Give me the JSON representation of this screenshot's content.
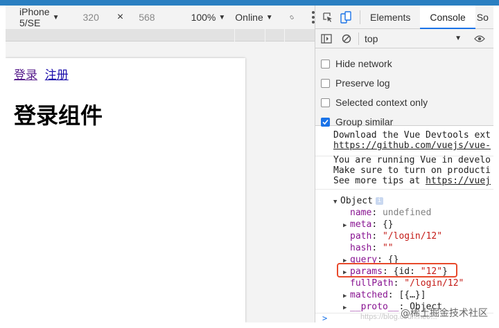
{
  "device_toolbar": {
    "device": "iPhone 5/SE",
    "width": "320",
    "times": "×",
    "height": "568",
    "zoom": "100%",
    "network": "Online"
  },
  "page": {
    "links": [
      "登录",
      "注册"
    ],
    "heading": "登录组件"
  },
  "devtools": {
    "tabs": [
      "Elements",
      "Console",
      "So"
    ],
    "active_tab": "Console",
    "context": "top",
    "options": [
      {
        "label": "Hide network",
        "checked": false
      },
      {
        "label": "Preserve log",
        "checked": false
      },
      {
        "label": "Selected context only",
        "checked": false
      },
      {
        "label": "Group similar",
        "checked": true
      }
    ],
    "messages": {
      "m1_line1": "Download the Vue Devtools ext",
      "m1_line2": "https://github.com/vuejs/vue-",
      "m2_line1": "You are running Vue in develo",
      "m2_line2": "Make sure to turn on producti",
      "m2_line3_prefix": "See more tips at ",
      "m2_line3_link": "https://vuej"
    },
    "object_tree": {
      "root": "Object",
      "info": "i",
      "name_key": "name",
      "name_val": "undefined",
      "meta_key": "meta",
      "meta_val": "{}",
      "path_key": "path",
      "path_val": "\"/login/12\"",
      "hash_key": "hash",
      "hash_val": "\"\"",
      "query_key": "query",
      "query_val": "{}",
      "params_key": "params",
      "params_open": "{id: ",
      "params_id": "\"12\"",
      "params_close": "}",
      "fullpath_key": "fullPath",
      "fullpath_val": "\"/login/12\"",
      "matched_key": "matched",
      "matched_val": "[{…}]",
      "proto_key": "__proto__",
      "proto_val": "Object"
    },
    "prompt": ">"
  },
  "watermark": "@稀土掘金技术社区",
  "watermark_faint": "https://blog.csdn.net/...",
  "colors": {
    "frame": "#2a7fc1",
    "highlight": "#e8492b",
    "accent": "#1a73e8"
  }
}
